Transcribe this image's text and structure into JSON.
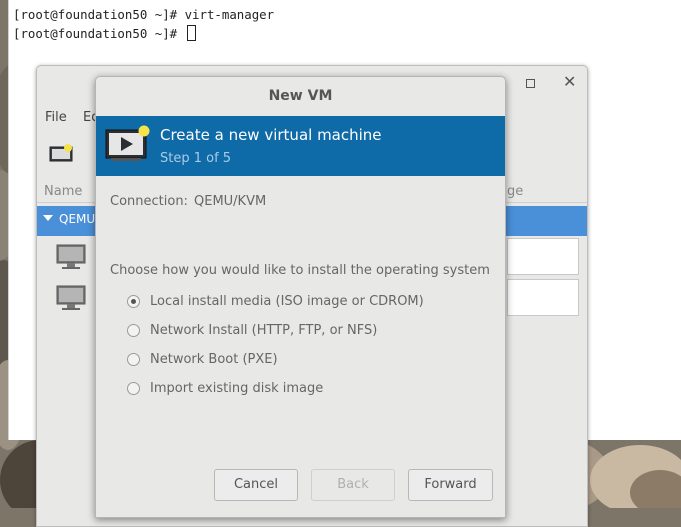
{
  "terminal": {
    "lines": [
      "[root@foundation50 ~]# virt-manager",
      "[root@foundation50 ~]# "
    ]
  },
  "main_window": {
    "menu": [
      "File",
      "Ed"
    ],
    "column_headers": {
      "name": "Name",
      "usage": "ge"
    },
    "connection_row_label": "QEMU/",
    "vm_icon": "monitor-icon",
    "new_vm_icon": "new-vm-icon"
  },
  "dialog": {
    "title": "New VM",
    "banner": {
      "title": "Create a new virtual machine",
      "step": "Step 1 of 5",
      "icon": "monitor-play-icon"
    },
    "connection": {
      "label": "Connection:",
      "value": "QEMU/KVM"
    },
    "choose_label": "Choose how you would like to install the operating system",
    "options": [
      {
        "label": "Local install media (ISO image or CDROM)",
        "checked": true
      },
      {
        "label": "Network Install (HTTP, FTP, or NFS)",
        "checked": false
      },
      {
        "label": "Network Boot (PXE)",
        "checked": false
      },
      {
        "label": "Import existing disk image",
        "checked": false
      }
    ],
    "buttons": {
      "cancel": "Cancel",
      "back": "Back",
      "forward": "Forward"
    }
  },
  "colors": {
    "banner": "#0f6aa8",
    "selection": "#4a90d9"
  }
}
